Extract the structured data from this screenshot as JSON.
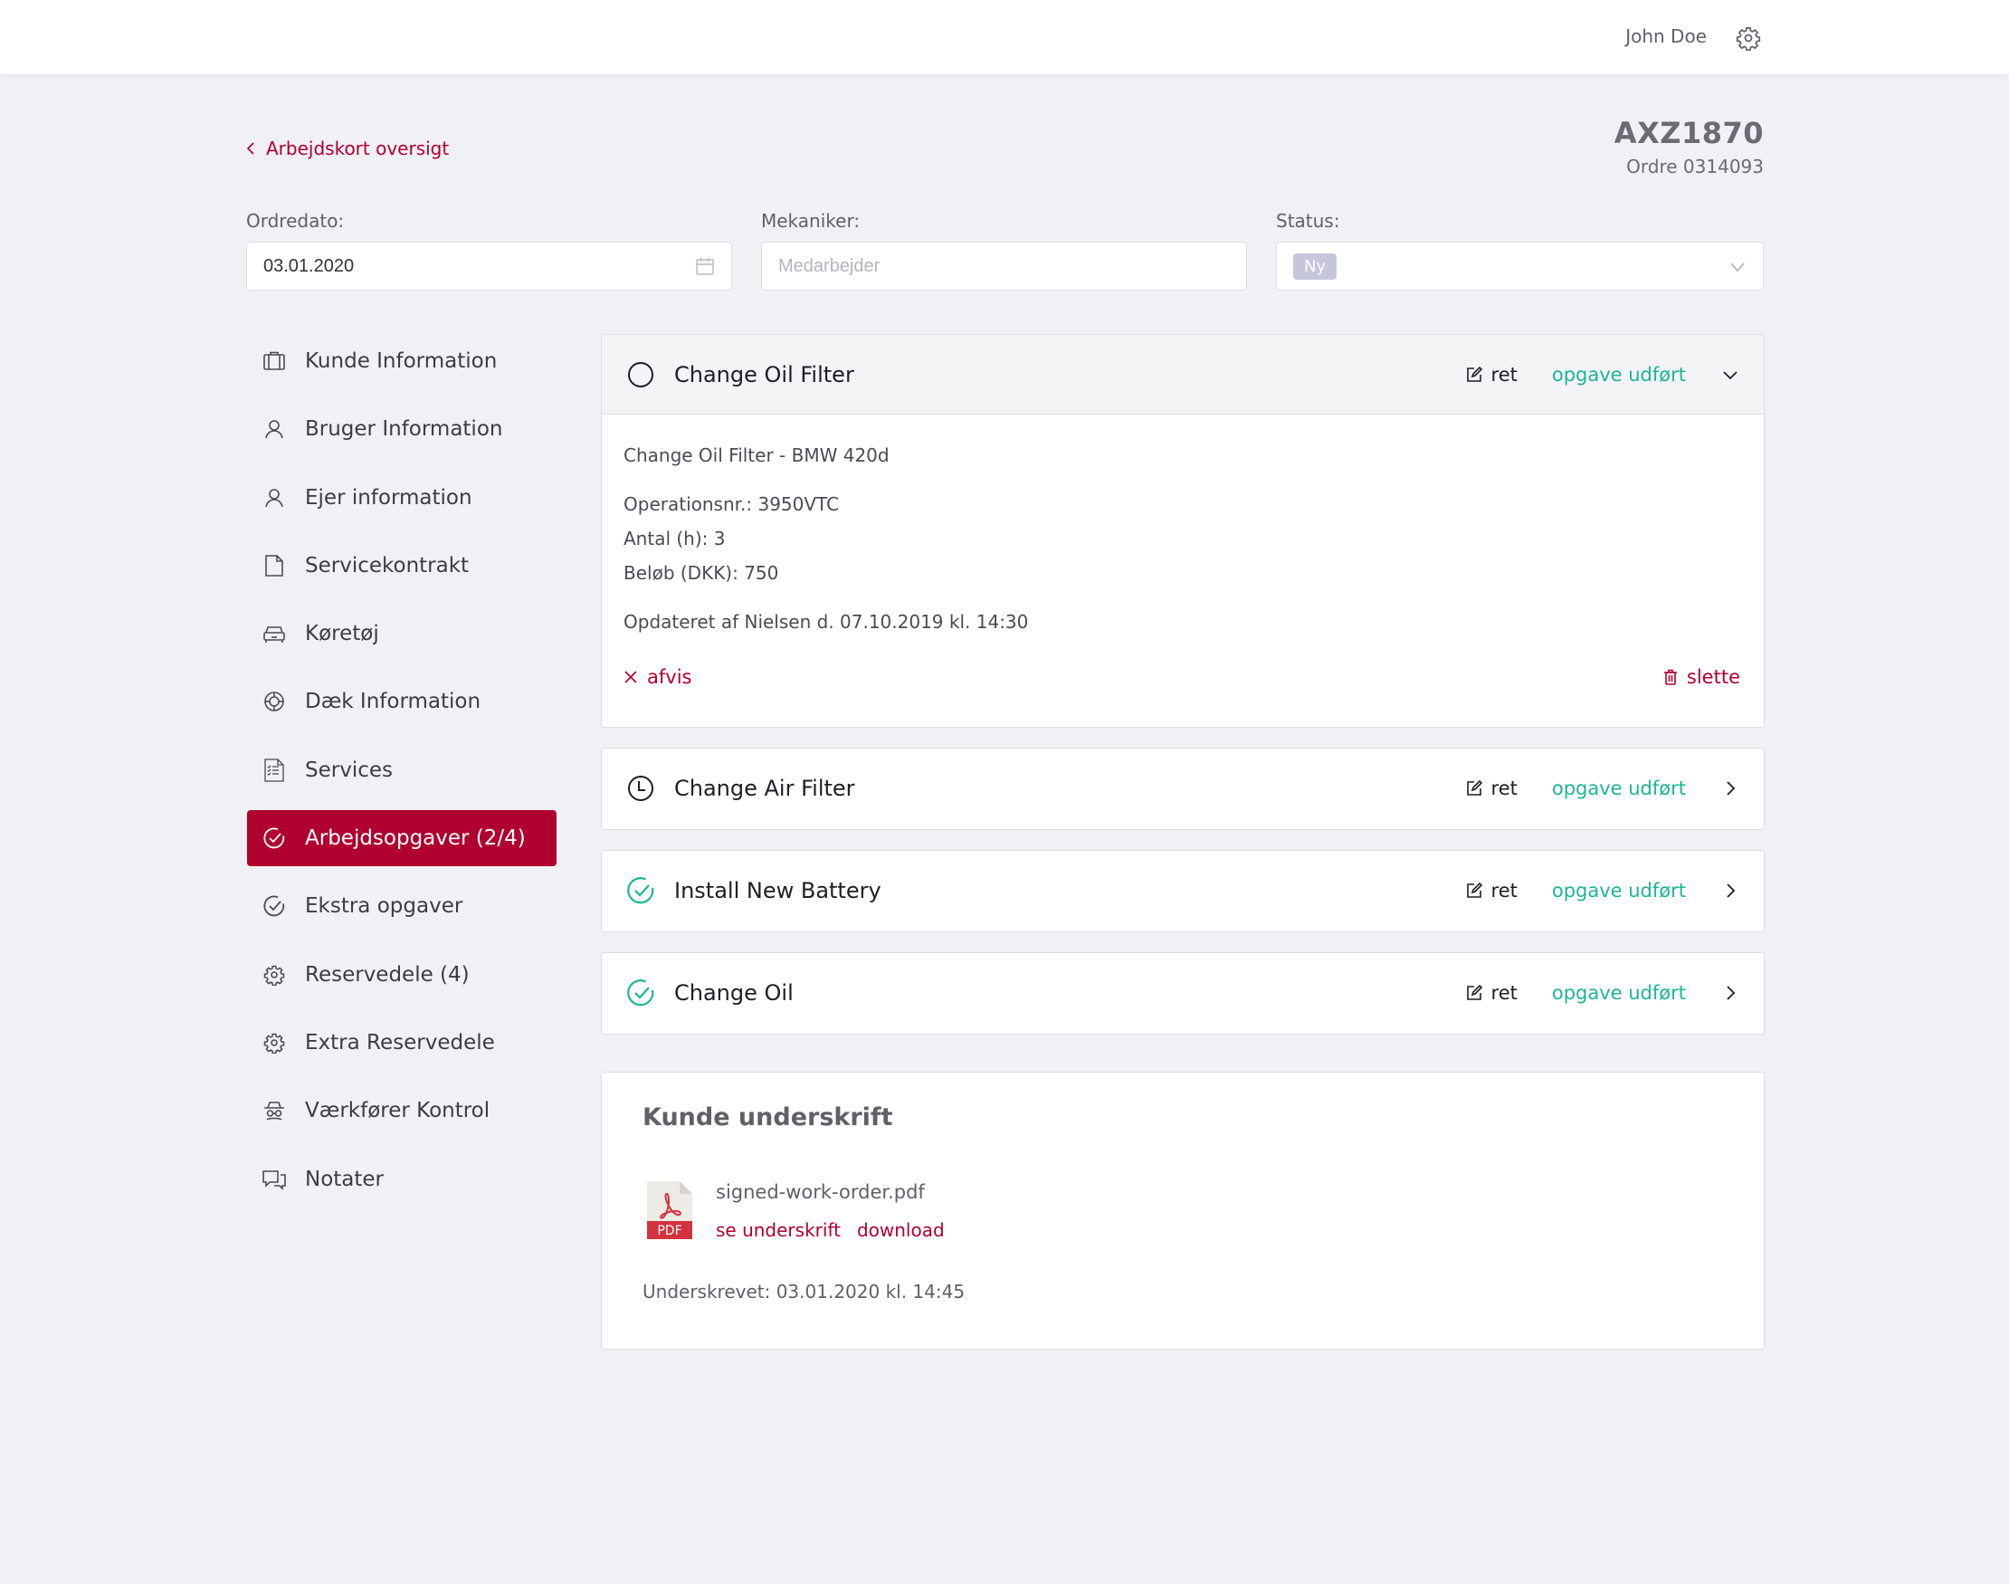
{
  "header": {
    "user_name": "John Doe",
    "settings_icon": "gear-icon"
  },
  "breadcrumb": {
    "back_label": "Arbejdskort oversigt"
  },
  "vehicle": {
    "plate": "AXZ1870",
    "order": "Ordre 0314093"
  },
  "fields": {
    "order_date": {
      "label": "Ordredato:",
      "value": "03.01.2020"
    },
    "mechanic": {
      "label": "Mekaniker:",
      "value": "",
      "placeholder": "Medarbejder"
    },
    "status": {
      "label": "Status:",
      "value": "Ny"
    }
  },
  "sidebar": {
    "items": [
      {
        "label": "Kunde Information",
        "icon": "briefcase-icon",
        "active": false
      },
      {
        "label": "Bruger Information",
        "icon": "user-icon",
        "active": false
      },
      {
        "label": "Ejer information",
        "icon": "user-icon",
        "active": false
      },
      {
        "label": "Servicekontrakt",
        "icon": "document-icon",
        "active": false
      },
      {
        "label": "Køretøj",
        "icon": "car-icon",
        "active": false
      },
      {
        "label": "Dæk Information",
        "icon": "tire-icon",
        "active": false
      },
      {
        "label": "Services",
        "icon": "checklist-icon",
        "active": false
      },
      {
        "label": "Arbejdsopgaver (2/4)",
        "icon": "check-circle-icon",
        "active": true
      },
      {
        "label": "Ekstra opgaver",
        "icon": "check-circle-icon",
        "active": false
      },
      {
        "label": "Reservedele (4)",
        "icon": "gear-icon",
        "active": false
      },
      {
        "label": "Extra Reservedele",
        "icon": "gear-icon",
        "active": false
      },
      {
        "label": "Værkfører Kontrol",
        "icon": "inspector-icon",
        "active": false
      },
      {
        "label": "Notater",
        "icon": "chat-icon",
        "active": false
      }
    ]
  },
  "tasks": [
    {
      "title": "Change Oil Filter",
      "status": "open",
      "status_icon": "circle-icon",
      "expanded": true,
      "edit_label": "ret",
      "done_label": "opgave udført",
      "details": {
        "description": "Change Oil Filter - BMW 420d",
        "operation_no": "Operationsnr.: 3950VTC",
        "hours": "Antal (h): 3",
        "amount": "Beløb (DKK): 750",
        "updated": "Opdateret af Nielsen d. 07.10.2019 kl. 14:30"
      },
      "reject_label": "afvis",
      "delete_label": "slette"
    },
    {
      "title": "Change Air Filter",
      "status": "in-progress",
      "status_icon": "clock-icon",
      "expanded": false,
      "edit_label": "ret",
      "done_label": "opgave udført"
    },
    {
      "title": "Install New Battery",
      "status": "done",
      "status_icon": "check-circle-icon",
      "expanded": false,
      "edit_label": "ret",
      "done_label": "opgave udført"
    },
    {
      "title": "Change Oil",
      "status": "done",
      "status_icon": "check-circle-icon",
      "expanded": false,
      "edit_label": "ret",
      "done_label": "opgave udført"
    }
  ],
  "signature": {
    "title": "Kunde underskrift",
    "file_name": "signed-work-order.pdf",
    "file_badge": "PDF",
    "view_label": "se underskrift",
    "download_label": "download",
    "signed_at": "Underskrevet: 03.01.2020 kl. 14:45"
  },
  "colors": {
    "brand": "#b0002f",
    "success": "#1db595",
    "background": "#f0f1f5",
    "status_badge": "#c5c6da"
  }
}
